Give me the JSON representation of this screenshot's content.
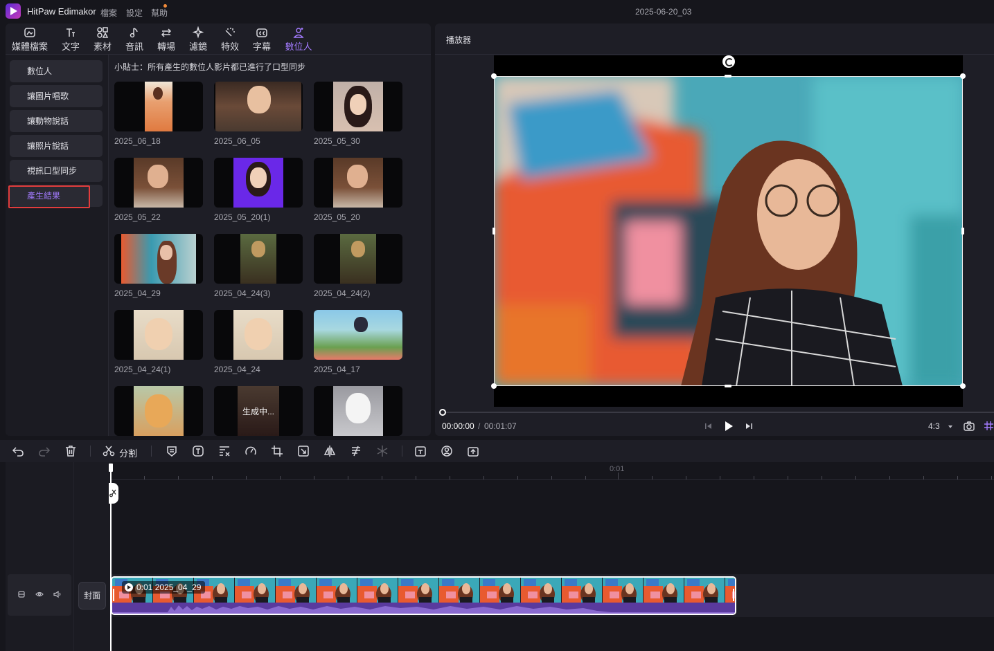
{
  "app": {
    "name": "HitPaw Edimakor",
    "menu": [
      "檔案",
      "設定",
      "幫助"
    ],
    "project_name": "2025-06-20_03"
  },
  "tabs": [
    {
      "label": "媒體檔案",
      "icon": "media-icon"
    },
    {
      "label": "文字",
      "icon": "text-icon"
    },
    {
      "label": "素材",
      "icon": "elements-icon"
    },
    {
      "label": "音訊",
      "icon": "audio-icon"
    },
    {
      "label": "轉場",
      "icon": "transition-icon"
    },
    {
      "label": "濾鏡",
      "icon": "filter-icon"
    },
    {
      "label": "特效",
      "icon": "effects-icon"
    },
    {
      "label": "字幕",
      "icon": "subtitle-icon"
    },
    {
      "label": "數位人",
      "icon": "avatar-icon",
      "active": true
    }
  ],
  "subnav": [
    {
      "label": "數位人"
    },
    {
      "label": "讓圖片唱歌"
    },
    {
      "label": "讓動物說話"
    },
    {
      "label": "讓照片說話"
    },
    {
      "label": "視訊口型同步"
    },
    {
      "label": "產生結果",
      "active": true
    }
  ],
  "tip": "小貼士：所有產生的數位人影片都已進行了口型同步",
  "results": [
    {
      "caption": "2025_06_18"
    },
    {
      "caption": "2025_06_05"
    },
    {
      "caption": "2025_05_30"
    },
    {
      "caption": "2025_05_22"
    },
    {
      "caption": "2025_05_20(1)"
    },
    {
      "caption": "2025_05_20"
    },
    {
      "caption": "2025_04_29"
    },
    {
      "caption": "2025_04_24(3)"
    },
    {
      "caption": "2025_04_24(2)"
    },
    {
      "caption": "2025_04_24(1)"
    },
    {
      "caption": "2025_04_24"
    },
    {
      "caption": "2025_04_17"
    },
    {
      "caption": ""
    },
    {
      "caption": "",
      "status": "生成中..."
    },
    {
      "caption": ""
    }
  ],
  "player": {
    "title": "播放器",
    "current_time": "00:00:00",
    "separator": "/",
    "total_time": "00:01:07",
    "aspect_ratio": "4:3"
  },
  "toolbar": {
    "split_label": "分割"
  },
  "timeline": {
    "ruler_label": "0:01",
    "cover_label": "封面",
    "clip_label": "0:01 2025_04_29"
  },
  "colors": {
    "accent": "#a37bff",
    "highlight_outline": "#e23c3c",
    "audio_wave": "#5a3a9e"
  }
}
